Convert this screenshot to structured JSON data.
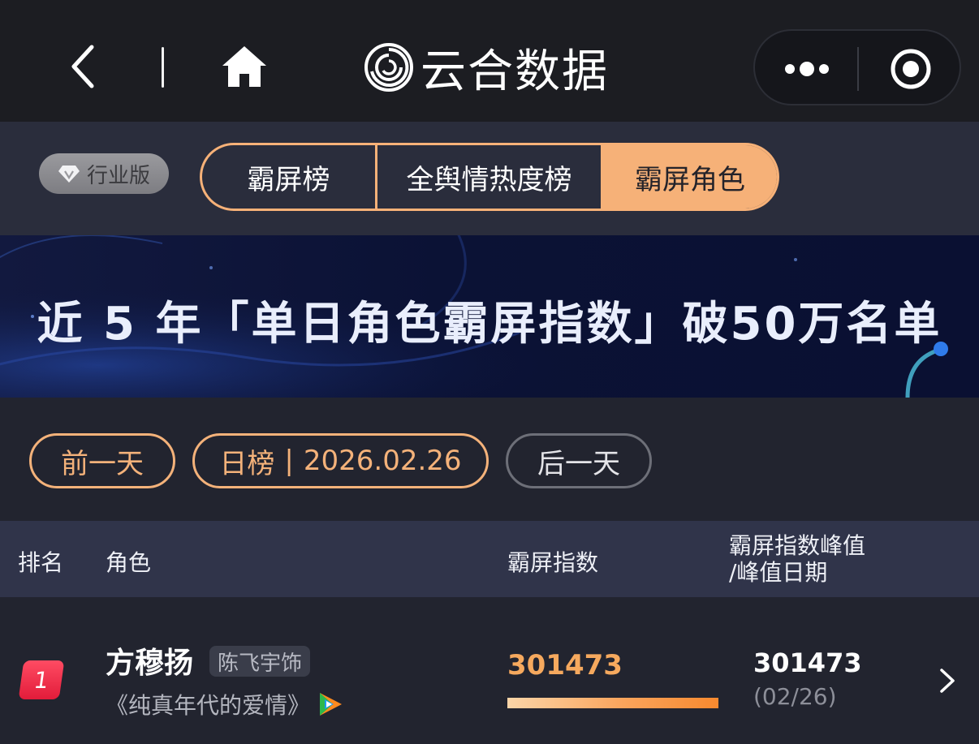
{
  "nav": {
    "brand_name": "云合数据",
    "icons": {
      "back": "chevron-left-icon",
      "home": "home-icon",
      "logo": "brand-logo-icon",
      "more": "more-dots-icon",
      "close": "target-close-icon"
    }
  },
  "tabs": {
    "edition_badge": "行业版",
    "items": [
      {
        "label": "霸屏榜",
        "active": false
      },
      {
        "label": "全舆情热度榜",
        "active": false
      },
      {
        "label": "霸屏角色",
        "active": true
      }
    ],
    "accent_color": "#f6b178"
  },
  "banner": {
    "text": "近 5 年「单日角色霸屏指数」破50万名单"
  },
  "date_nav": {
    "prev_label": "前一天",
    "chart_type": "日榜",
    "date": "2026.02.26",
    "next_label": "后一天"
  },
  "table": {
    "headers": {
      "rank": "排名",
      "role": "角色",
      "index": "霸屏指数",
      "peak_line1": "霸屏指数峰值",
      "peak_line2": "/峰值日期"
    },
    "rows": [
      {
        "rank": "1",
        "role_name": "方穆扬",
        "actor_tag": "陈飞宇饰",
        "drama": "《纯真年代的爱情》",
        "platform_icon": "tencent-video-icon",
        "score": "301473",
        "score_bar_fraction": 1.0,
        "peak_value": "301473",
        "peak_date": "(02/26)"
      }
    ]
  },
  "colors": {
    "background": "#22242f",
    "navbar": "#1c1d22",
    "score_orange": "#f6a95e",
    "rank_red": "#e8273f"
  }
}
